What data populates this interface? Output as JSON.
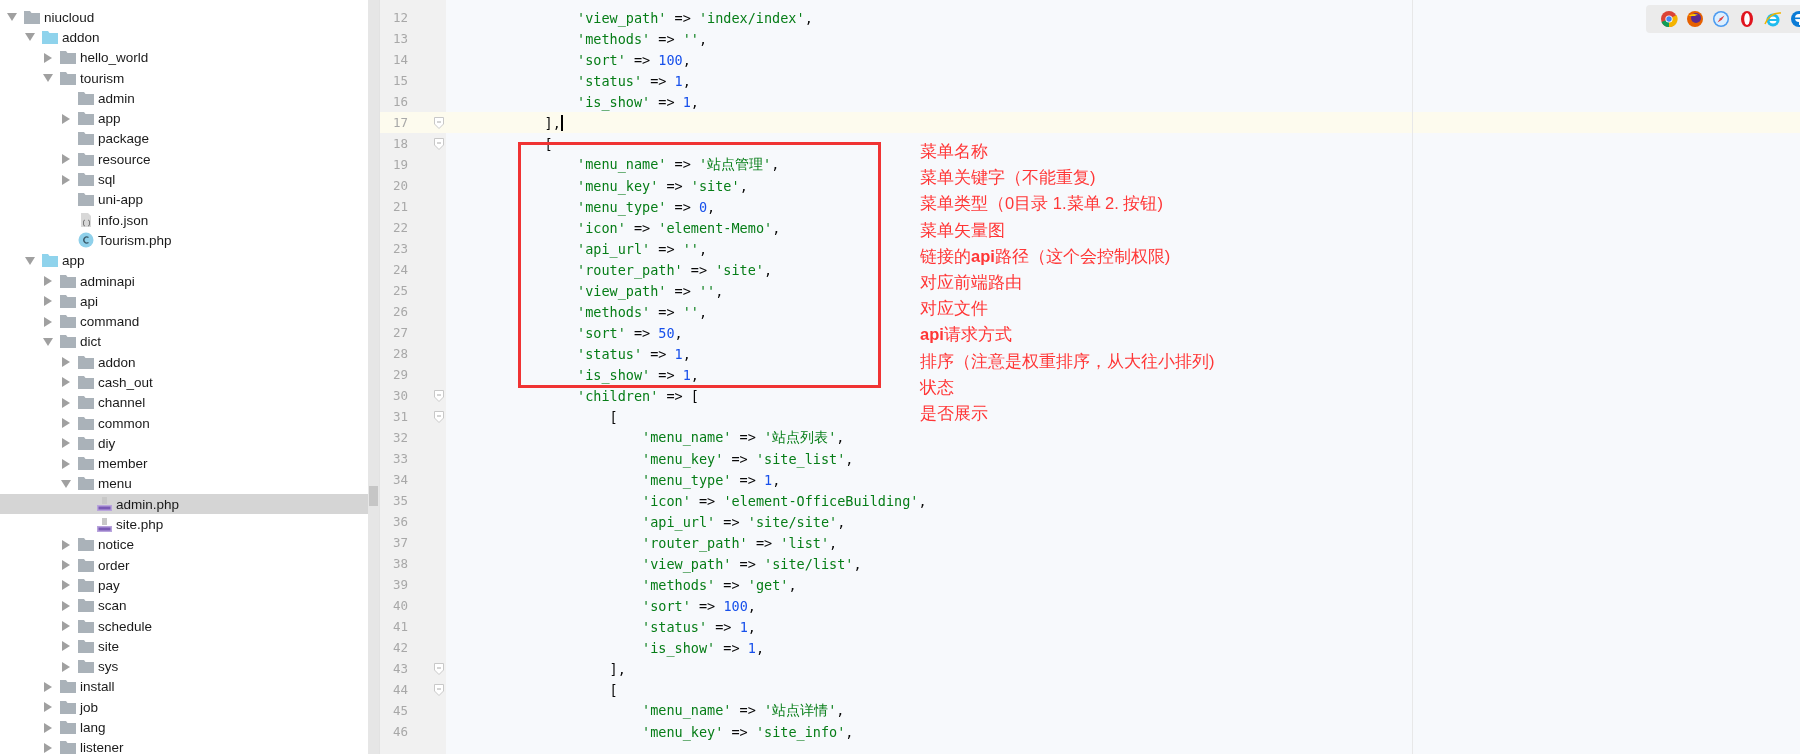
{
  "project_tree": [
    {
      "name": "niucloud",
      "kind": "folder",
      "expanded": true,
      "selected": false,
      "children": [
        {
          "name": "addon",
          "kind": "source_folder",
          "expanded": true,
          "selected": false,
          "children": [
            {
              "name": "hello_world",
              "kind": "folder",
              "expanded": false,
              "selected": false
            },
            {
              "name": "tourism",
              "kind": "folder",
              "expanded": true,
              "selected": false,
              "children": [
                {
                  "name": "admin",
                  "kind": "folder",
                  "selected": false
                },
                {
                  "name": "app",
                  "kind": "folder",
                  "expanded": false,
                  "selected": false
                },
                {
                  "name": "package",
                  "kind": "folder",
                  "selected": false
                },
                {
                  "name": "resource",
                  "kind": "folder",
                  "expanded": false,
                  "selected": false
                },
                {
                  "name": "sql",
                  "kind": "folder",
                  "expanded": false,
                  "selected": false
                },
                {
                  "name": "uni-app",
                  "kind": "folder",
                  "selected": false
                },
                {
                  "name": "info.json",
                  "kind": "json",
                  "selected": false
                },
                {
                  "name": "Tourism.php",
                  "kind": "class",
                  "selected": false
                }
              ]
            }
          ]
        },
        {
          "name": "app",
          "kind": "source_folder",
          "expanded": true,
          "selected": false,
          "children": [
            {
              "name": "adminapi",
              "kind": "folder",
              "expanded": false,
              "selected": false
            },
            {
              "name": "api",
              "kind": "folder",
              "expanded": false,
              "selected": false
            },
            {
              "name": "command",
              "kind": "folder",
              "expanded": false,
              "selected": false
            },
            {
              "name": "dict",
              "kind": "folder",
              "expanded": true,
              "selected": false,
              "children": [
                {
                  "name": "addon",
                  "kind": "folder",
                  "expanded": false,
                  "selected": false
                },
                {
                  "name": "cash_out",
                  "kind": "folder",
                  "expanded": false,
                  "selected": false
                },
                {
                  "name": "channel",
                  "kind": "folder",
                  "expanded": false,
                  "selected": false
                },
                {
                  "name": "common",
                  "kind": "folder",
                  "expanded": false,
                  "selected": false
                },
                {
                  "name": "diy",
                  "kind": "folder",
                  "expanded": false,
                  "selected": false
                },
                {
                  "name": "member",
                  "kind": "folder",
                  "expanded": false,
                  "selected": false
                },
                {
                  "name": "menu",
                  "kind": "folder",
                  "expanded": true,
                  "selected": false,
                  "children": [
                    {
                      "name": "admin.php",
                      "kind": "php",
                      "selected": true
                    },
                    {
                      "name": "site.php",
                      "kind": "php",
                      "selected": false
                    }
                  ]
                },
                {
                  "name": "notice",
                  "kind": "folder",
                  "expanded": false,
                  "selected": false
                },
                {
                  "name": "order",
                  "kind": "folder",
                  "expanded": false,
                  "selected": false
                },
                {
                  "name": "pay",
                  "kind": "folder",
                  "expanded": false,
                  "selected": false
                },
                {
                  "name": "scan",
                  "kind": "folder",
                  "expanded": false,
                  "selected": false
                },
                {
                  "name": "schedule",
                  "kind": "folder",
                  "expanded": false,
                  "selected": false
                },
                {
                  "name": "site",
                  "kind": "folder",
                  "expanded": false,
                  "selected": false
                },
                {
                  "name": "sys",
                  "kind": "folder",
                  "expanded": false,
                  "selected": false
                }
              ]
            },
            {
              "name": "install",
              "kind": "folder",
              "expanded": false,
              "selected": false
            },
            {
              "name": "job",
              "kind": "folder",
              "expanded": false,
              "selected": false
            },
            {
              "name": "lang",
              "kind": "folder",
              "expanded": false,
              "selected": false
            },
            {
              "name": "listener",
              "kind": "folder",
              "expanded": false,
              "selected": false
            }
          ]
        }
      ]
    }
  ],
  "editor": {
    "lines": [
      {
        "n": "12",
        "text": "                'view_path' => 'index/index',",
        "current": false,
        "fold": false
      },
      {
        "n": "13",
        "text": "                'methods' => '',",
        "current": false,
        "fold": false
      },
      {
        "n": "14",
        "text": "                'sort' => 100,",
        "current": false,
        "fold": false
      },
      {
        "n": "15",
        "text": "                'status' => 1,",
        "current": false,
        "fold": false
      },
      {
        "n": "16",
        "text": "                'is_show' => 1,",
        "current": false,
        "fold": false
      },
      {
        "n": "17",
        "text": "            ],",
        "current": true,
        "fold": true
      },
      {
        "n": "18",
        "text": "            [",
        "current": false,
        "fold": true
      },
      {
        "n": "19",
        "text": "                'menu_name' => '站点管理',",
        "current": false,
        "fold": false
      },
      {
        "n": "20",
        "text": "                'menu_key' => 'site',",
        "current": false,
        "fold": false
      },
      {
        "n": "21",
        "text": "                'menu_type' => 0,",
        "current": false,
        "fold": false
      },
      {
        "n": "22",
        "text": "                'icon' => 'element-Memo',",
        "current": false,
        "fold": false
      },
      {
        "n": "23",
        "text": "                'api_url' => '',",
        "current": false,
        "fold": false
      },
      {
        "n": "24",
        "text": "                'router_path' => 'site',",
        "current": false,
        "fold": false
      },
      {
        "n": "25",
        "text": "                'view_path' => '',",
        "current": false,
        "fold": false
      },
      {
        "n": "26",
        "text": "                'methods' => '',",
        "current": false,
        "fold": false
      },
      {
        "n": "27",
        "text": "                'sort' => 50,",
        "current": false,
        "fold": false
      },
      {
        "n": "28",
        "text": "                'status' => 1,",
        "current": false,
        "fold": false
      },
      {
        "n": "29",
        "text": "                'is_show' => 1,",
        "current": false,
        "fold": false
      },
      {
        "n": "30",
        "text": "                'children' => [",
        "current": false,
        "fold": true
      },
      {
        "n": "31",
        "text": "                    [",
        "current": false,
        "fold": true
      },
      {
        "n": "32",
        "text": "                        'menu_name' => '站点列表',",
        "current": false,
        "fold": false
      },
      {
        "n": "33",
        "text": "                        'menu_key' => 'site_list',",
        "current": false,
        "fold": false
      },
      {
        "n": "34",
        "text": "                        'menu_type' => 1,",
        "current": false,
        "fold": false
      },
      {
        "n": "35",
        "text": "                        'icon' => 'element-OfficeBuilding',",
        "current": false,
        "fold": false
      },
      {
        "n": "36",
        "text": "                        'api_url' => 'site/site',",
        "current": false,
        "fold": false
      },
      {
        "n": "37",
        "text": "                        'router_path' => 'list',",
        "current": false,
        "fold": false
      },
      {
        "n": "38",
        "text": "                        'view_path' => 'site/list',",
        "current": false,
        "fold": false
      },
      {
        "n": "39",
        "text": "                        'methods' => 'get',",
        "current": false,
        "fold": false
      },
      {
        "n": "40",
        "text": "                        'sort' => 100,",
        "current": false,
        "fold": false
      },
      {
        "n": "41",
        "text": "                        'status' => 1,",
        "current": false,
        "fold": false
      },
      {
        "n": "42",
        "text": "                        'is_show' => 1,",
        "current": false,
        "fold": false
      },
      {
        "n": "43",
        "text": "                    ],",
        "current": false,
        "fold": true
      },
      {
        "n": "44",
        "text": "                    [",
        "current": false,
        "fold": true
      },
      {
        "n": "45",
        "text": "                        'menu_name' => '站点详情',",
        "current": false,
        "fold": false
      },
      {
        "n": "46",
        "text": "                        'menu_key' => 'site_info',",
        "current": false,
        "fold": false
      }
    ]
  },
  "annotations": [
    "菜单名称",
    "菜单关键字（不能重复)",
    "菜单类型（0目录  1.菜单 2. 按钮)",
    "菜单矢量图",
    "链接的**api**路径（这个会控制权限)",
    "对应前端路由",
    "对应文件",
    "**api**请求方式",
    "排序（注意是权重排序，从大往小排列)",
    "状态",
    "是否展示"
  ]
}
